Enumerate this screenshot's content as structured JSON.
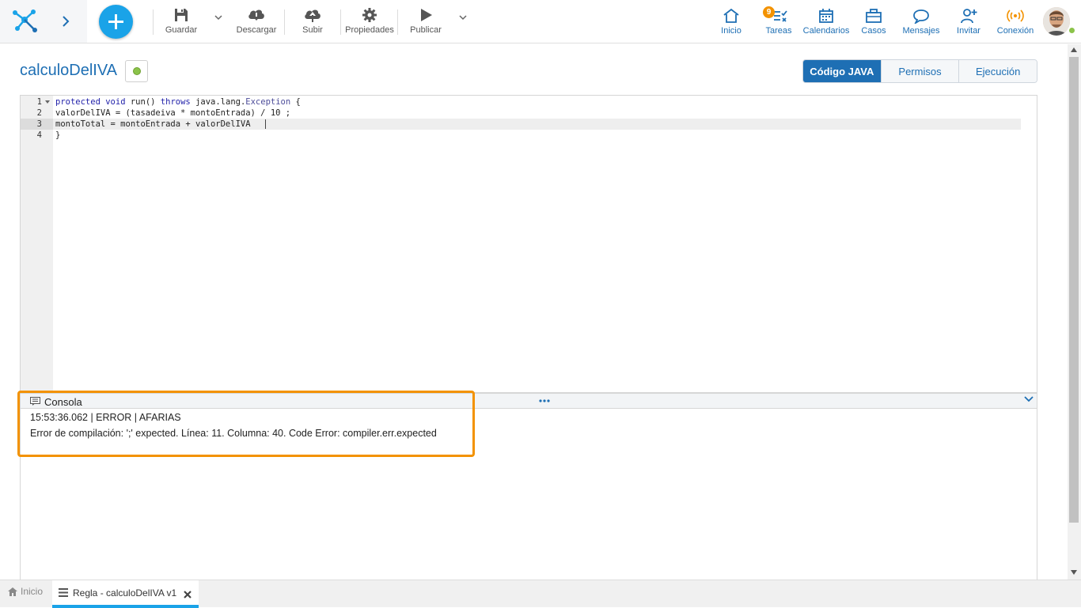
{
  "toolbar": {
    "guardar": "Guardar",
    "descargar": "Descargar",
    "subir": "Subir",
    "propiedades": "Propiedades",
    "publicar": "Publicar"
  },
  "nav": {
    "inicio": "Inicio",
    "tareas": "Tareas",
    "tareas_badge": "9",
    "calendarios": "Calendarios",
    "casos": "Casos",
    "mensajes": "Mensajes",
    "invitar": "Invitar",
    "conexion": "Conexión"
  },
  "page": {
    "title": "calculoDelIVA"
  },
  "tabs": [
    {
      "label": "Código JAVA",
      "active": true
    },
    {
      "label": "Permisos",
      "active": false
    },
    {
      "label": "Ejecución",
      "active": false
    }
  ],
  "editor": {
    "line_numbers": [
      "1",
      "2",
      "3",
      "4"
    ],
    "lines": {
      "l1_kw1": "protected",
      "l1_kw2": "void",
      "l1_mid": "run()",
      "l1_kw3": "throws",
      "l1_type": "java.lang.",
      "l1_exc": "Exception",
      "l1_end": "{",
      "l2": "valorDelIVA = (tasadeiva * montoEntrada) / 10 ;",
      "l3": "montoTotal = montoEntrada + valorDelIVA",
      "l4": "}"
    }
  },
  "console": {
    "title": "Consola",
    "log_line": "15:53:36.062 | ERROR | AFARIAS",
    "error_line": "Error de compilación: ';' expected. Línea: 11. Columna: 40. Code Error: compiler.err.expected"
  },
  "bottom_tabs": {
    "home": "Inicio",
    "rule": "Regla - calculoDelIVA v1"
  },
  "colors": {
    "accent": "#1e6fb4",
    "add_button": "#1aa3e8",
    "highlight": "#f39200",
    "status_dot": "#8bc34a",
    "badge": "#f39200"
  }
}
